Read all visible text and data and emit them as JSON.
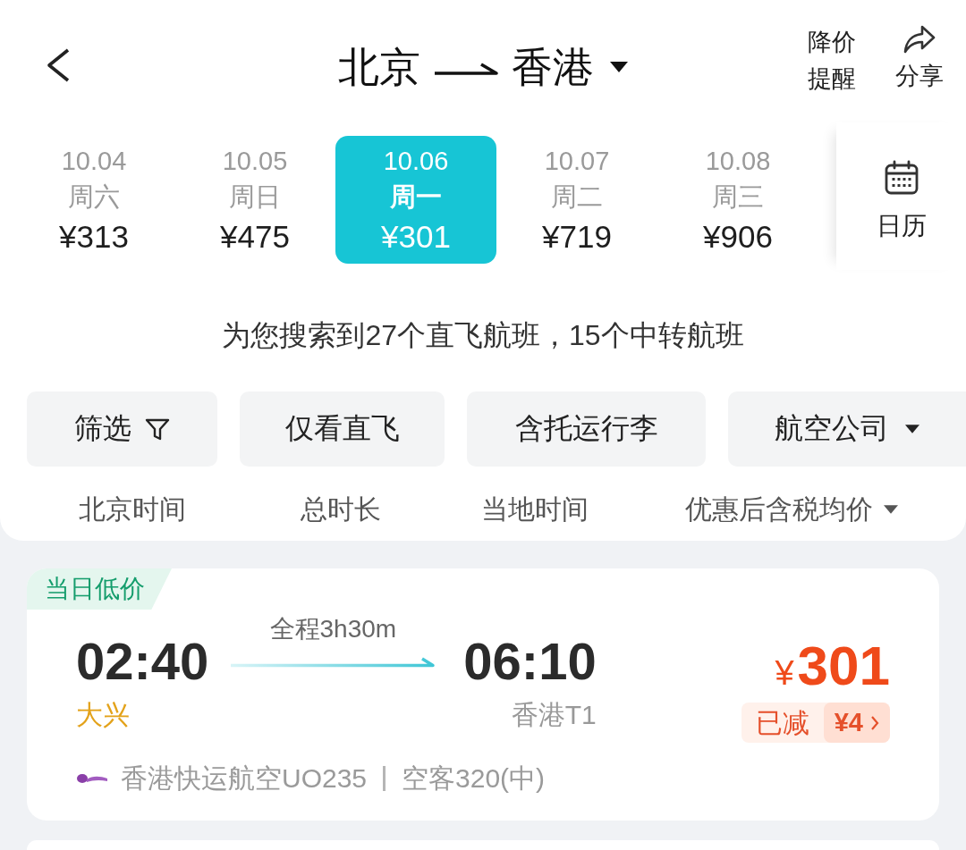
{
  "header": {
    "route": {
      "from": "北京",
      "to": "香港"
    },
    "actions": [
      {
        "kind": "alert",
        "label": "降价提醒"
      },
      {
        "kind": "share",
        "label": "分享"
      }
    ]
  },
  "dates": [
    {
      "date": "10.04",
      "weekday": "周六",
      "price": "¥313",
      "selected": false
    },
    {
      "date": "10.05",
      "weekday": "周日",
      "price": "¥475",
      "selected": false
    },
    {
      "date": "10.06",
      "weekday": "周一",
      "price": "¥301",
      "selected": true
    },
    {
      "date": "10.07",
      "weekday": "周二",
      "price": "¥719",
      "selected": false
    },
    {
      "date": "10.08",
      "weekday": "周三",
      "price": "¥906",
      "selected": false
    }
  ],
  "calendar": {
    "label": "日历"
  },
  "summary": "为您搜索到27个直飞航班，15个中转航班",
  "filters": [
    {
      "kind": "filter",
      "label": "筛选"
    },
    {
      "kind": "plain",
      "label": "仅看直飞"
    },
    {
      "kind": "plain",
      "label": "含托运行李"
    },
    {
      "kind": "dropdown",
      "label": "航空公司"
    }
  ],
  "sort": [
    {
      "kind": "plain",
      "label": "北京时间"
    },
    {
      "kind": "plain",
      "label": "总时长"
    },
    {
      "kind": "plain",
      "label": "当地时间"
    },
    {
      "kind": "dropdown",
      "label": "优惠后含税均价"
    }
  ],
  "flights": [
    {
      "tag": "当日低价",
      "depart_time": "02:40",
      "depart_airport": "大兴",
      "duration": "全程3h30m",
      "arrive_time": "06:10",
      "arrive_airport": "香港T1",
      "currency": "¥",
      "price": "301",
      "discount": {
        "label": "已减",
        "amount": "¥4"
      },
      "airline": "香港快运航空UO235",
      "aircraft": "空客320(中)"
    }
  ]
}
